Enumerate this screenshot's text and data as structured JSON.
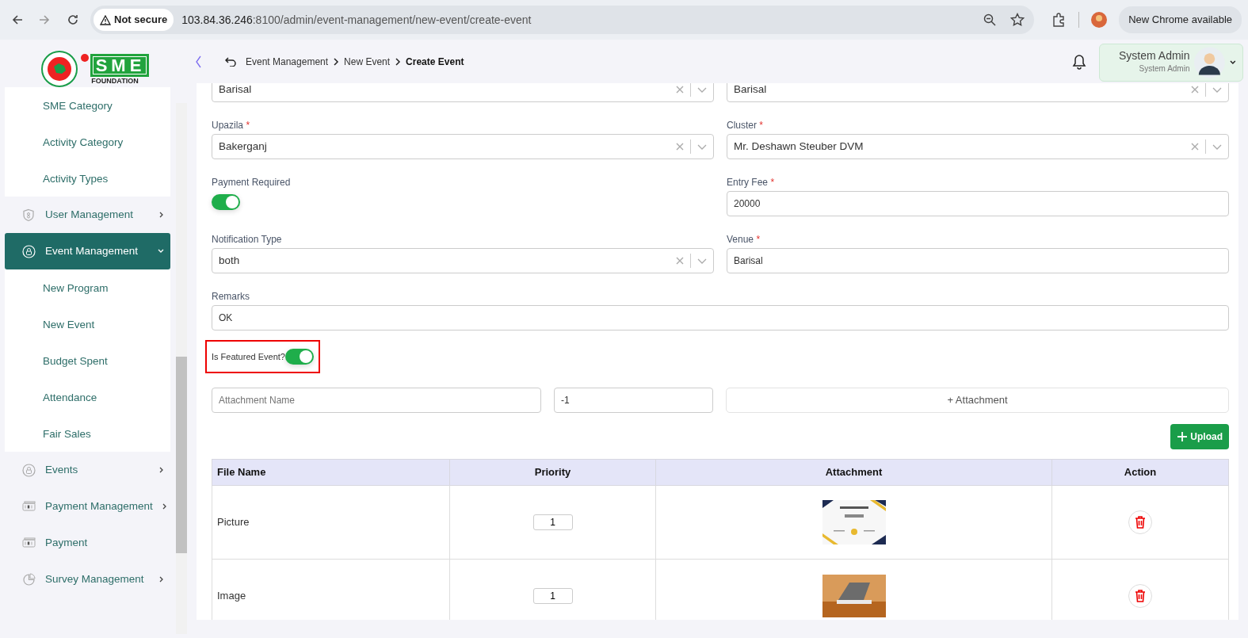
{
  "browser": {
    "security": "Not secure",
    "host": "103.84.36.246",
    "path": ":8100/admin/event-management/new-event/create-event",
    "update_button": "New Chrome available"
  },
  "logo": {
    "mark": "SME",
    "subtitle": "FOUNDATION"
  },
  "breadcrumb": [
    {
      "label": "Event Management",
      "current": false
    },
    {
      "label": "New Event",
      "current": false
    },
    {
      "label": "Create Event",
      "current": true
    }
  ],
  "user": {
    "name": "System Admin",
    "role": "System Admin"
  },
  "sidebar": {
    "items": [
      {
        "kind": "continued",
        "children": [
          {
            "label": "SME Category",
            "selected": false
          },
          {
            "label": "Activity Category",
            "selected": false
          },
          {
            "label": "Activity Types",
            "selected": false
          }
        ]
      },
      {
        "kind": "menu",
        "label": "User Management",
        "has_submenu": true,
        "expanded": false,
        "selected": false
      },
      {
        "kind": "menu",
        "label": "Event Management",
        "has_submenu": true,
        "expanded": true,
        "selected": true,
        "children": [
          {
            "label": "New Program",
            "selected": false
          },
          {
            "label": "New Event",
            "selected": false
          },
          {
            "label": "Budget Spent",
            "selected": false
          },
          {
            "label": "Attendance",
            "selected": false
          },
          {
            "label": "Fair Sales",
            "selected": false
          }
        ]
      },
      {
        "kind": "menu",
        "label": "Events",
        "has_submenu": true,
        "expanded": false,
        "selected": false
      },
      {
        "kind": "menu",
        "label": "Payment Management",
        "has_submenu": true,
        "expanded": false,
        "selected": false
      },
      {
        "kind": "menu",
        "label": "Payment",
        "has_submenu": false,
        "selected": false
      },
      {
        "kind": "menu",
        "label": "Survey Management",
        "has_submenu": true,
        "expanded": false,
        "selected": false
      }
    ]
  },
  "fields": [
    {
      "kind": "select",
      "value": "Barisal"
    },
    {
      "kind": "select",
      "value": "Barisal"
    },
    {
      "kind": "select",
      "label": "Upazila",
      "required_mark": "*",
      "value": "Bakerganj"
    },
    {
      "kind": "select",
      "label": "Cluster",
      "required_mark": "*",
      "value": "Mr. Deshawn Steuber DVM"
    },
    {
      "kind": "toggle",
      "label": "Payment Required",
      "on": true
    },
    {
      "kind": "input",
      "label": "Entry Fee",
      "required_mark": "*",
      "value": "20000"
    },
    {
      "kind": "select",
      "label": "Notification Type",
      "value": "both"
    },
    {
      "kind": "input",
      "label": "Venue",
      "required_mark": "*",
      "value": "Barisal"
    }
  ],
  "remarks": {
    "label": "Remarks",
    "value": "OK"
  },
  "featured": {
    "label": "Is Featured Event?",
    "on": true,
    "highlighted": true
  },
  "attachment_form": {
    "name_placeholder": "Attachment Name",
    "priority_value": "-1",
    "attach_button": "+ Attachment"
  },
  "upload_button": "Upload",
  "table": {
    "columns": [
      "File Name",
      "Priority",
      "Attachment",
      "Action"
    ],
    "rows": [
      {
        "file_name": "Picture",
        "priority": "1",
        "kind": "certificate"
      },
      {
        "file_name": "Image",
        "priority": "1",
        "kind": "photo"
      }
    ]
  }
}
